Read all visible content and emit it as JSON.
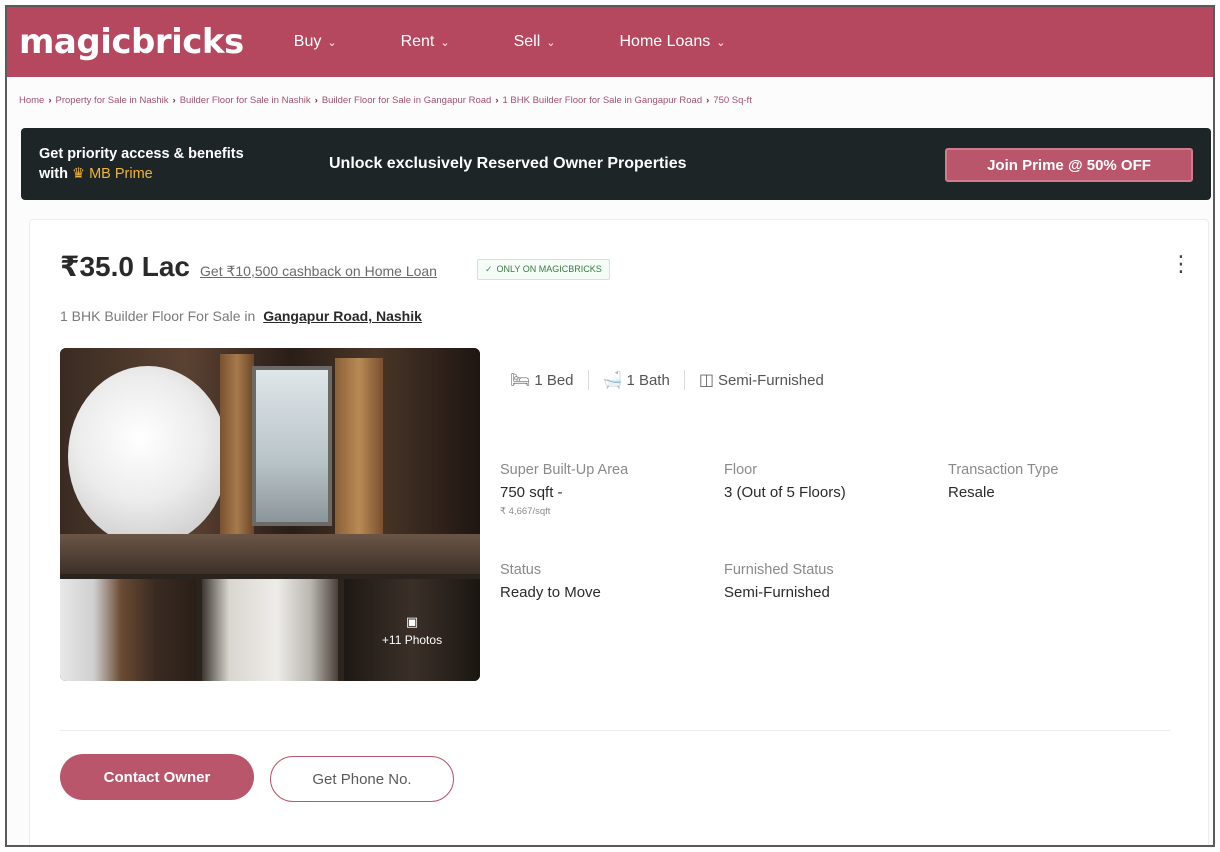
{
  "header": {
    "logo": "magicbricks",
    "nav": [
      {
        "label": "Buy"
      },
      {
        "label": "Rent"
      },
      {
        "label": "Sell"
      },
      {
        "label": "Home Loans"
      }
    ]
  },
  "breadcrumb": [
    "Home",
    "Property for Sale in Nashik",
    "Builder Floor for Sale in Nashik",
    "Builder Floor for Sale in Gangapur Road",
    "1 BHK Builder Floor for Sale in Gangapur Road",
    "750 Sq-ft"
  ],
  "prime": {
    "line1": "Get priority access & benefits",
    "line2_prefix": "with",
    "brand": "MB Prime",
    "center_text": "Unlock exclusively Reserved Owner Properties",
    "button_label": "Join Prime @ 50% OFF"
  },
  "listing": {
    "price": "₹35.0 Lac",
    "cashback": "Get ₹10,500 cashback on Home Loan",
    "badge": "ONLY ON MAGICBRICKS",
    "title_prefix": "1 BHK Builder Floor For Sale in",
    "location": "Gangapur Road, Nashik",
    "photos_more": "+11 Photos",
    "chips": {
      "bed": "1 Bed",
      "bath": "1 Bath",
      "furnish": "Semi-Furnished"
    },
    "details": {
      "area_label": "Super Built-Up Area",
      "area_value": "750 sqft -",
      "area_rate": "₹ 4,667/sqft",
      "floor_label": "Floor",
      "floor_value": "3 (Out of 5 Floors)",
      "txn_label": "Transaction Type",
      "txn_value": "Resale",
      "status_label": "Status",
      "status_value": "Ready to Move",
      "furnish_label": "Furnished Status",
      "furnish_value": "Semi-Furnished"
    },
    "actions": {
      "contact": "Contact Owner",
      "phone": "Get Phone No."
    }
  },
  "colors": {
    "brand": "#b5485f",
    "button": "#b9566c",
    "banner_bg": "#1d2526",
    "prime_gold": "#f0b43c"
  }
}
